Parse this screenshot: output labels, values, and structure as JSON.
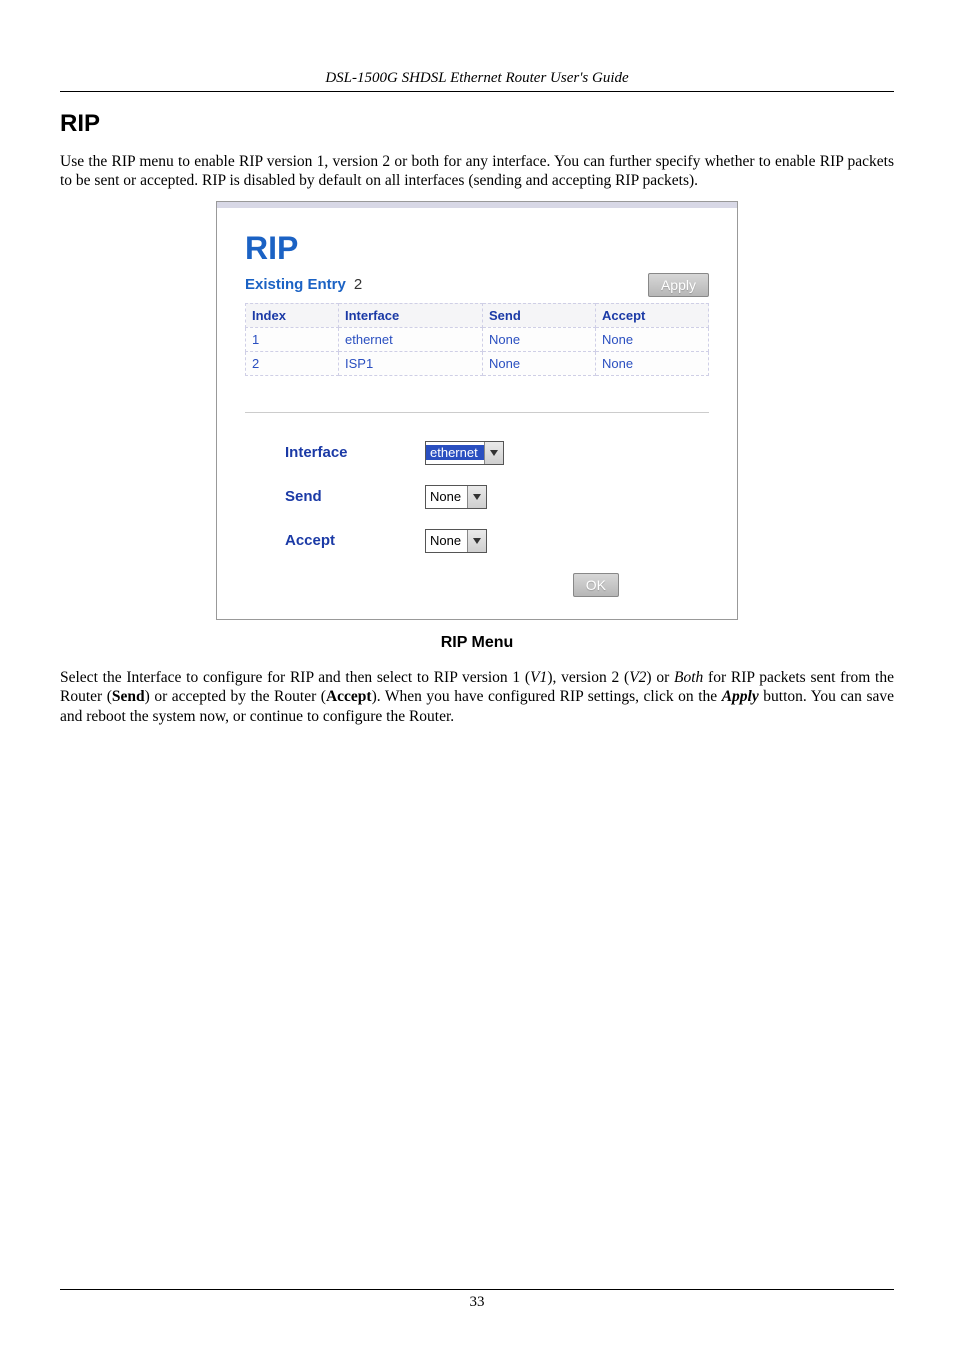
{
  "header": {
    "title": "DSL-1500G SHDSL Ethernet Router User's Guide"
  },
  "section": {
    "heading": "RIP",
    "intro": "Use the RIP menu to enable RIP version 1, version 2 or both for any interface. You can further specify whether to enable RIP packets to be sent or accepted. RIP is disabled by default on all interfaces (sending and accepting RIP packets)."
  },
  "figure": {
    "title": "RIP",
    "existing_label": "Existing Entry",
    "existing_count": "2",
    "apply_label": "Apply",
    "table": {
      "headers": {
        "index": "Index",
        "interface": "Interface",
        "send": "Send",
        "accept": "Accept"
      },
      "rows": [
        {
          "index": "1",
          "interface": "ethernet",
          "send": "None",
          "accept": "None"
        },
        {
          "index": "2",
          "interface": "ISP1",
          "send": "None",
          "accept": "None"
        }
      ]
    },
    "form": {
      "interface_label": "Interface",
      "interface_value": "ethernet",
      "send_label": "Send",
      "send_value": "None",
      "accept_label": "Accept",
      "accept_value": "None",
      "ok_label": "OK"
    },
    "caption": "RIP Menu"
  },
  "outro": {
    "text_before_v1": "Select the Interface to configure for RIP and then select to RIP version 1 (",
    "v1": "V1",
    "text_between_v1_v2": "), version 2 (",
    "v2": "V2",
    "text_after_v2": ") or ",
    "both": "Both",
    "text_after_both": " for RIP packets sent from the Router (",
    "send_bold": "Send",
    "text_between_send_accept": ") or accepted by the Router (",
    "accept_bold": "Accept",
    "text_after_accept": "). When you have configured RIP settings, click on the ",
    "apply_bi": "Apply",
    "text_end": " button. You can save and reboot the system now, or continue to configure the Router."
  },
  "footer": {
    "page": "33"
  }
}
